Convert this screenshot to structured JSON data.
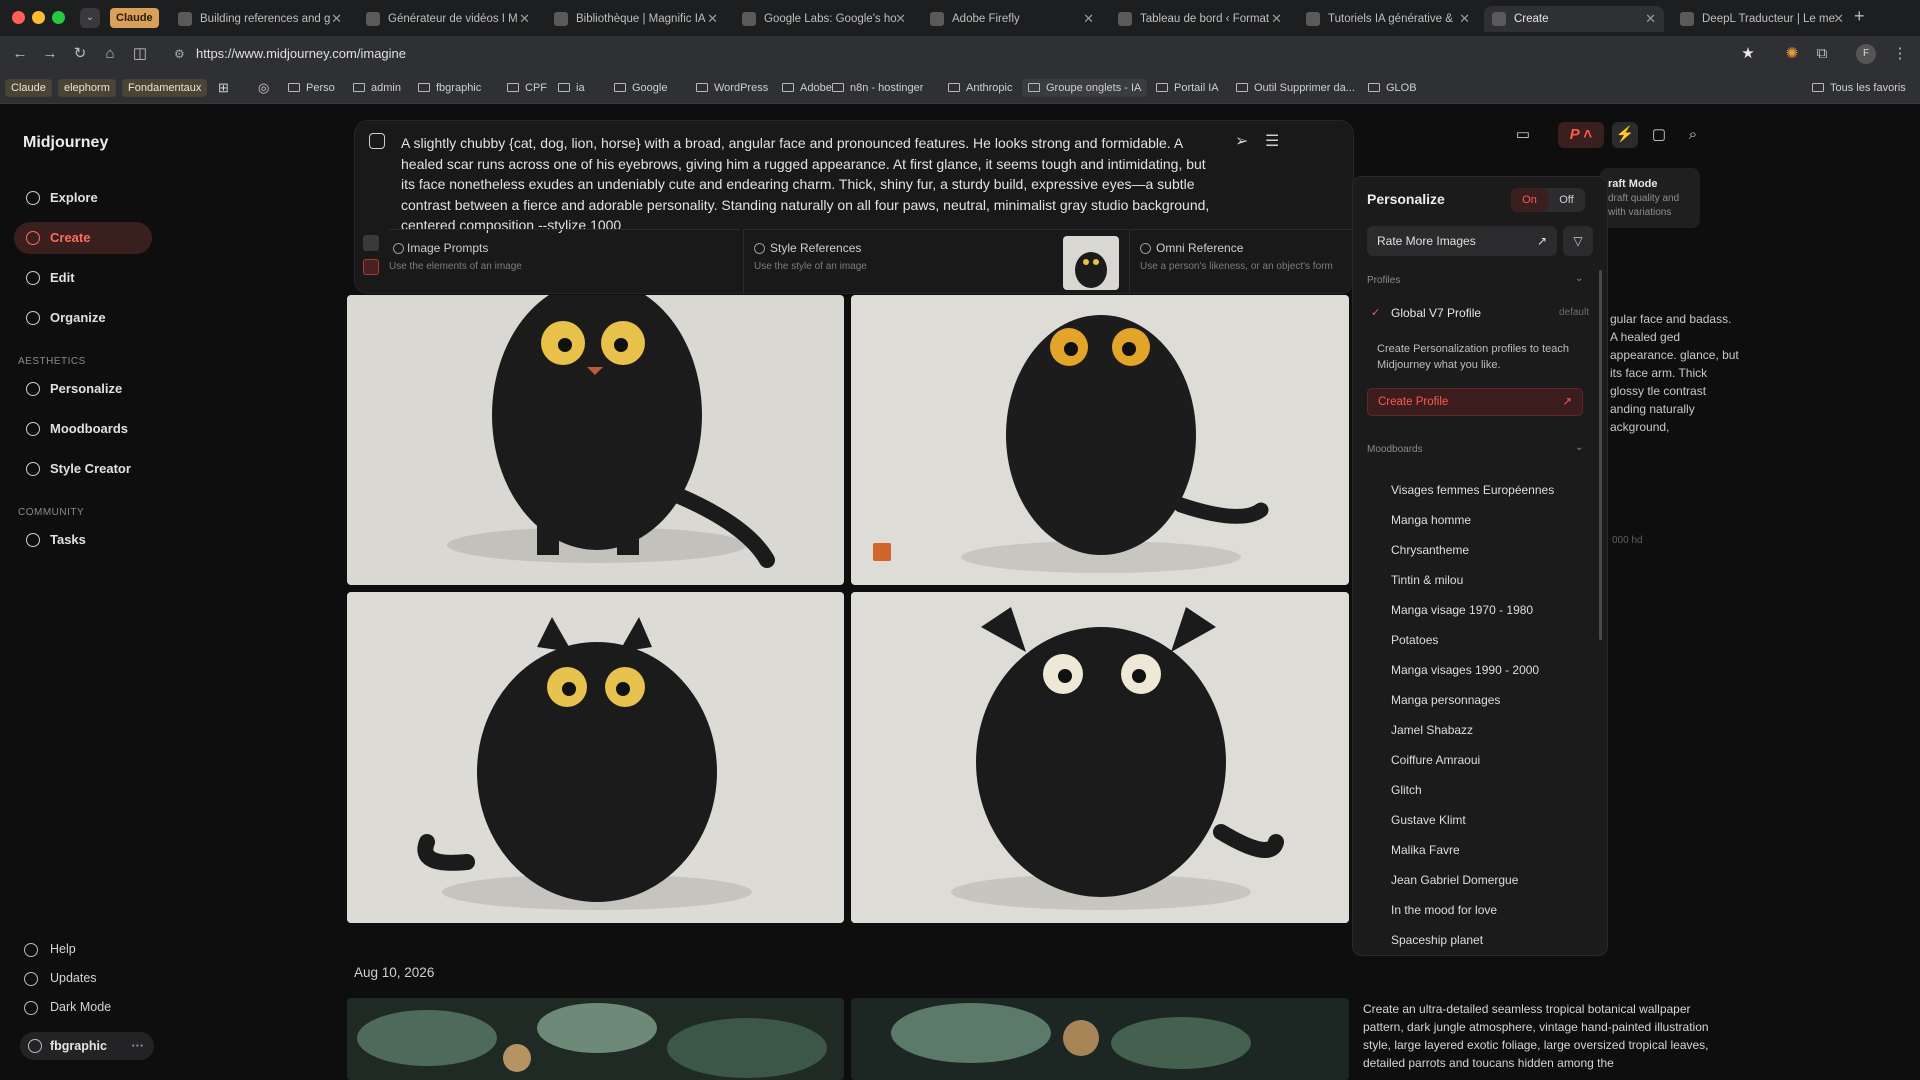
{
  "browser": {
    "tabs": [
      {
        "label": "Claude",
        "type": "group-pill"
      },
      {
        "label": "Building references and g",
        "icon": "notion-icon"
      },
      {
        "label": "Générateur de vidéos I M",
        "icon": "notion-icon"
      },
      {
        "label": "Bibliothèque | Magnific IA",
        "icon": "notion-icon"
      },
      {
        "label": "Google Labs: Google's ho",
        "icon": "google-labs-icon"
      },
      {
        "label": "Adobe Firefly",
        "icon": "adobe-icon"
      },
      {
        "label": "Tableau de bord ‹ Format",
        "icon": "wordpress-icon"
      },
      {
        "label": "Tutoriels IA générative &",
        "icon": "wordpress-icon"
      },
      {
        "label": "Create",
        "icon": "midjourney-icon",
        "active": true
      },
      {
        "label": "DeepL Traducteur | Le me",
        "icon": "deepl-icon"
      }
    ],
    "url": "https://www.midjourney.com/imagine",
    "bookmarks_left": [
      "Claude",
      "elephorm",
      "Fondamentaux"
    ],
    "bookmarks": [
      "Perso",
      "admin",
      "fbgraphic",
      "CPF",
      "ia",
      "Google",
      "WordPress",
      "Adobe",
      "n8n - hostinger",
      "Anthropic",
      "Groupe onglets - IA",
      "Portail IA",
      "Outil Supprimer da...",
      "GLOB"
    ],
    "all_bookmarks": "Tous les favoris"
  },
  "sidebar": {
    "brand": "Midjourney",
    "nav": [
      {
        "label": "Explore",
        "icon": "compass-icon"
      },
      {
        "label": "Create",
        "icon": "brush-icon",
        "active": true
      },
      {
        "label": "Edit",
        "icon": "edit-icon"
      },
      {
        "label": "Organize",
        "icon": "grid-icon"
      }
    ],
    "aesthetics_label": "AESTHETICS",
    "aesthetics": [
      {
        "label": "Personalize",
        "icon": "personalize-icon"
      },
      {
        "label": "Moodboards",
        "icon": "moodboard-icon"
      },
      {
        "label": "Style Creator",
        "icon": "style-creator-icon"
      }
    ],
    "community_label": "COMMUNITY",
    "community": [
      {
        "label": "Tasks",
        "icon": "thumbs-up-icon"
      }
    ],
    "bottom": [
      {
        "label": "Help",
        "icon": "help-icon"
      },
      {
        "label": "Updates",
        "icon": "bell-icon"
      },
      {
        "label": "Dark Mode",
        "icon": "moon-icon"
      }
    ],
    "user": "fbgraphic"
  },
  "prompt": {
    "text": "A slightly chubby {cat, dog, lion, horse} with a broad, angular face and pronounced features. He looks strong and formidable. A healed scar runs across one of his eyebrows, giving him a rugged appearance. At first glance, it seems tough and intimidating, but its face nonetheless exudes an undeniably cute and endearing charm. Thick, shiny fur, a sturdy build, expressive eyes—a subtle contrast between a fierce and adorable personality. Standing naturally on all four paws, neutral, minimalist gray studio background, centered composition --stylize 1000",
    "refs": [
      {
        "title": "Image Prompts",
        "sub": "Use the elements of an image"
      },
      {
        "title": "Style References",
        "sub": "Use the style of an image"
      },
      {
        "title": "Omni Reference",
        "sub": "Use a person's likeness, or an object's form"
      }
    ]
  },
  "personalize": {
    "title": "Personalize",
    "on": "On",
    "off": "Off",
    "rate": "Rate More Images",
    "profiles_label": "Profiles",
    "global_profile": "Global V7 Profile",
    "default_tag": "default",
    "desc": "Create Personalization profiles to teach Midjourney what you like.",
    "create_profile": "Create Profile",
    "moodboards_label": "Moodboards",
    "moodboards": [
      "Visages femmes Européennes",
      "Manga homme",
      "Chrysantheme",
      "Tintin & milou",
      "Manga visage 1970 - 1980",
      "Potatoes",
      "Manga visages 1990 - 2000",
      "Manga personnages",
      "Jamel Shabazz",
      "Coiffure Amraoui",
      "Glitch",
      "Gustave Klimt",
      "Malika Favre",
      "Jean Gabriel Domergue",
      "In the mood for love",
      "Spaceship planet"
    ]
  },
  "tooltip": {
    "title": "raft Mode",
    "text": "draft quality and with variations"
  },
  "background_text": "gular face and badass. A healed ged appearance. glance, but its face arm. Thick glossy tle contrast anding naturally ackground,",
  "background_tags": "000   hd",
  "date": "Aug 10, 2026",
  "second_prompt": "Create an ultra-detailed seamless tropical botanical wallpaper pattern, dark jungle atmosphere, vintage hand-painted illustration style, large layered exotic foliage, large oversized tropical leaves, detailed parrots and toucans hidden among the",
  "colors": {
    "accent": "#ff5a4e",
    "bg": "#0e0e0f",
    "panel": "#1b1b1c"
  }
}
